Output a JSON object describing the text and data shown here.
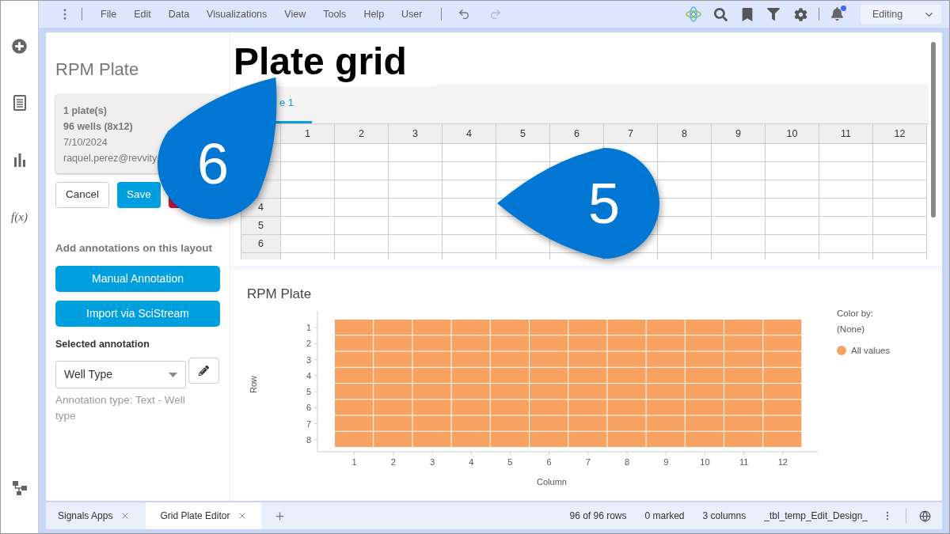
{
  "sidebar": {
    "items": [
      {
        "kind": "add"
      },
      {
        "kind": "document"
      },
      {
        "kind": "chart"
      },
      {
        "kind": "formula",
        "label": "f(x)"
      },
      {
        "kind": "flow"
      }
    ]
  },
  "menu_bar": {
    "items": [
      "File",
      "Edit",
      "Data",
      "Visualizations",
      "View",
      "Tools",
      "Help",
      "User"
    ],
    "undo": {
      "disabled": false
    },
    "redo": {
      "disabled": true
    },
    "notifications": {
      "unread": true
    },
    "mode": "Editing"
  },
  "layout_panel": {
    "title": "RPM Plate",
    "info": [
      {
        "text": "1 plate(s)",
        "bold": true
      },
      {
        "text": "96 wells (8x12)",
        "bold": true
      },
      {
        "text": "7/10/2024",
        "bold": false
      },
      {
        "text": "raquel.perez@revvity",
        "bold": false
      }
    ],
    "buttons": [
      {
        "kind": "outline",
        "label": "Cancel"
      },
      {
        "kind": "primary",
        "label": "Save"
      },
      {
        "kind": "danger"
      }
    ],
    "annotations_heading": "Add annotations on this layout",
    "annotation_buttons": [
      "Manual Annotation",
      "Import via SciStream"
    ],
    "selected_label": "Selected annotation",
    "selected_value": "Well Type",
    "annotation_type": "Annotation type: Text - Well type"
  },
  "overlay_title": "Plate grid",
  "plate_grid": {
    "tabs": [
      {
        "label": "e 1",
        "selected": true
      }
    ],
    "columns": [
      "1",
      "2",
      "3",
      "4",
      "5",
      "6",
      "7",
      "8",
      "9",
      "10",
      "11",
      "12"
    ],
    "rows": [
      {},
      {},
      {},
      {
        "label": "4"
      },
      {
        "label": "5"
      },
      {
        "label": "6"
      }
    ]
  },
  "plate_chart": {
    "title": "RPM Plate",
    "y_title": "Row",
    "x_title": "Column",
    "row_labels": [
      "1",
      "2",
      "3",
      "4",
      "5",
      "6",
      "7",
      "8"
    ],
    "column_labels": [
      "1",
      "2",
      "3",
      "4",
      "5",
      "6",
      "7",
      "8",
      "9",
      "10",
      "11",
      "12"
    ],
    "legend_title": "Color by:",
    "legend_subtitle": "(None)",
    "legend": [
      {
        "label": "All values",
        "color": "#f8a262"
      }
    ]
  },
  "callouts": [
    {
      "label": "6"
    },
    {
      "label": "5"
    }
  ],
  "tab_bar": {
    "tabs": [
      {
        "label": "Signals Apps",
        "selected": false
      },
      {
        "label": "Grid Plate Editor",
        "selected": true
      }
    ]
  },
  "status_bar": [
    "96 of 96 rows",
    "0 marked",
    "3 columns",
    "_tbl_temp_Edit_Design_"
  ]
}
